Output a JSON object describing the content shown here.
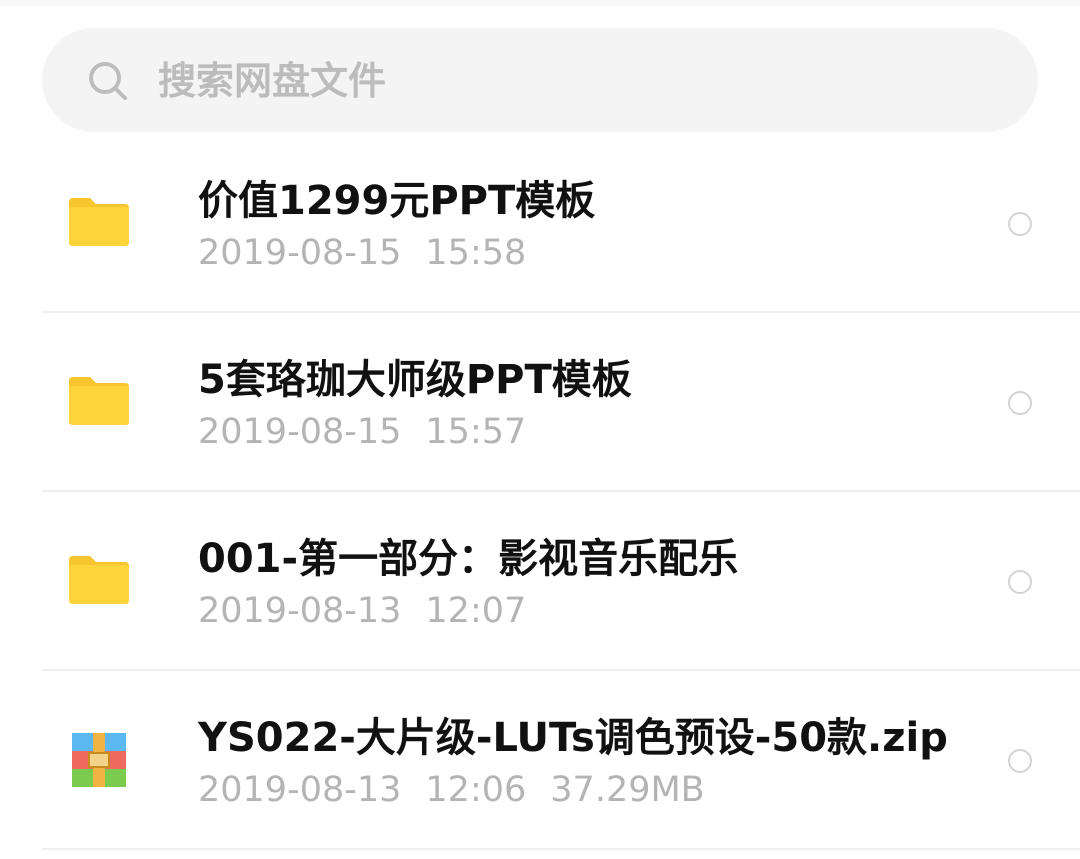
{
  "search": {
    "placeholder": "搜索网盘文件"
  },
  "files": [
    {
      "type": "folder",
      "icon": "folder-icon",
      "name": "价值1299元PPT模板",
      "date": "2019-08-15",
      "time": "15:58",
      "size": ""
    },
    {
      "type": "folder",
      "icon": "folder-icon",
      "name": "5套珞珈大师级PPT模板",
      "date": "2019-08-15",
      "time": "15:57",
      "size": ""
    },
    {
      "type": "folder",
      "icon": "folder-icon",
      "name": "001-第一部分：影视音乐配乐",
      "date": "2019-08-13",
      "time": "12:07",
      "size": ""
    },
    {
      "type": "archive",
      "icon": "zip-archive-icon",
      "name": "YS022-大片级-LUTs调色预设-50款.zip",
      "date": "2019-08-13",
      "time": "12:06",
      "size": "37.29MB"
    }
  ],
  "colors": {
    "folder": "#FFD43B",
    "folder_tab": "#F7C52D",
    "search_bg": "#F4F4F4",
    "meta_text": "#B4B4B4",
    "name_text": "#111111"
  }
}
